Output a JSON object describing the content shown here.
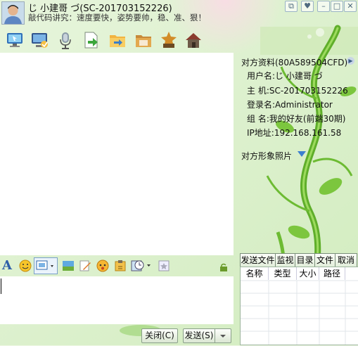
{
  "header": {
    "title": "じ 小建哥 づ(SC-201703152226)",
    "motto": "敲代码讲究：速度要快，姿势要帅，稳、准、狠！"
  },
  "window_controls": [
    "restore-icon",
    "skin-icon",
    "minimize-icon",
    "maximize-icon",
    "close-icon"
  ],
  "toolbar": {
    "icons": [
      "remote-desktop-icon",
      "screen-monitor-icon",
      "voice-mic-icon",
      "send-file-icon",
      "transfer-folder-icon",
      "shared-folder-icon",
      "user-settings-icon",
      "home-icon"
    ]
  },
  "format_bar": {
    "icons": [
      "font-icon",
      "emoticon-icon",
      "screenshot-icon",
      "image-icon",
      "handwriting-icon",
      "nudge-icon",
      "file-icon",
      "history-icon",
      "extra-icon"
    ]
  },
  "footer": {
    "close_label": "关闭(C)",
    "send_label": "发送(S)"
  },
  "info_panel": {
    "title": "对方资料(80A589504CFD)",
    "rows": [
      {
        "label": "用户名:",
        "value": "じ 小建哥 づ"
      },
      {
        "label": "主  机:",
        "value": "SC-201703152226"
      },
      {
        "label": "登录名:",
        "value": "Administrator"
      },
      {
        "label": "组  名:",
        "value": "我的好友(前端30期)"
      },
      {
        "label": "IP地址:",
        "value": "192.168.161.58"
      }
    ],
    "photo_label": "对方形象照片"
  },
  "file_panel": {
    "tabs": [
      "发送文件",
      "监视",
      "目录",
      "文件",
      "取消"
    ],
    "columns": [
      "名称",
      "类型",
      "大小",
      "路径"
    ]
  }
}
